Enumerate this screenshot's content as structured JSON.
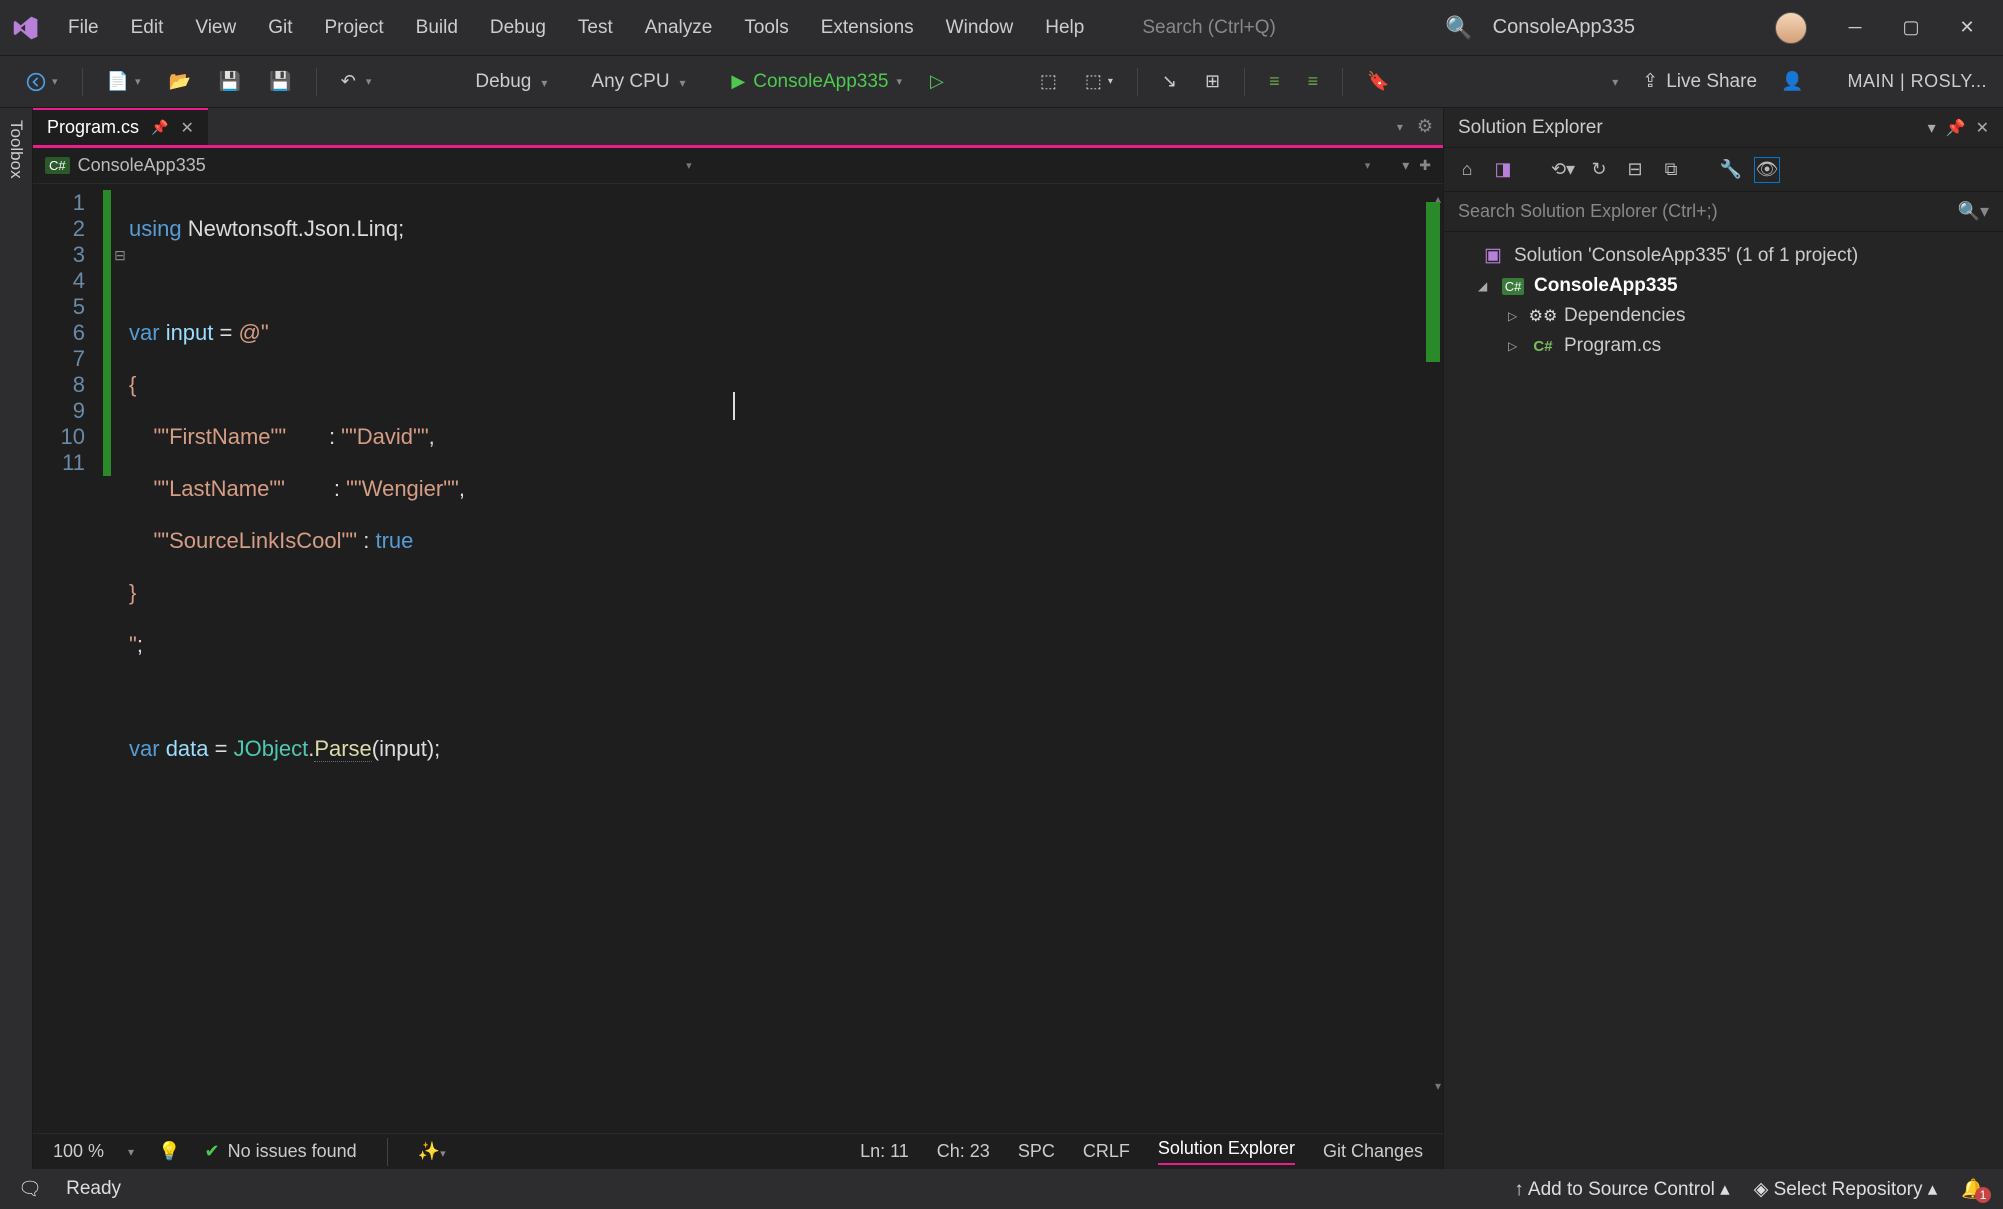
{
  "title": "ConsoleApp335",
  "menu": [
    "File",
    "Edit",
    "View",
    "Git",
    "Project",
    "Build",
    "Debug",
    "Test",
    "Analyze",
    "Tools",
    "Extensions",
    "Window",
    "Help"
  ],
  "search_placeholder": "Search (Ctrl+Q)",
  "toolbar": {
    "config": "Debug",
    "platform": "Any CPU",
    "run_target": "ConsoleApp335",
    "live_share": "Live Share",
    "branch": "MAIN | ROSLY..."
  },
  "toolbox_label": "Toolbox",
  "tab": {
    "name": "Program.cs"
  },
  "nav": {
    "project": "ConsoleApp335"
  },
  "code": {
    "lines": [
      "1",
      "2",
      "3",
      "4",
      "5",
      "6",
      "7",
      "8",
      "9",
      "10",
      "11"
    ],
    "l1_kw": "using",
    "l1_ns": "Newtonsoft",
    "l1_d1": ".",
    "l1_p2": "Json",
    "l1_d2": ".",
    "l1_p3": "Linq",
    "l1_end": ";",
    "l3_kw": "var",
    "l3_id": "input",
    "l3_eq": " = ",
    "l3_str": "@\"",
    "l4": "{",
    "l5_k": "    \"\"FirstName\"\"       ",
    "l5_c": ": ",
    "l5_v": "\"\"David\"\"",
    "l5_e": ",",
    "l6_k": "    \"\"LastName\"\"        ",
    "l6_c": ": ",
    "l6_v": "\"\"Wengier\"\"",
    "l6_e": ",",
    "l7_k": "    \"\"SourceLinkIsCool\"\" ",
    "l7_c": ": ",
    "l7_v": "true",
    "l8": "}",
    "l9": "\"",
    "l9_e": ";",
    "l11_kw": "var",
    "l11_id": "data",
    "l11_eq": " = ",
    "l11_cls": "JObject",
    "l11_d": ".",
    "l11_m": "Parse",
    "l11_a": "(input);"
  },
  "editor_status": {
    "zoom": "100 %",
    "issues": "No issues found",
    "ln": "Ln: 11",
    "ch": "Ch: 23",
    "spc": "SPC",
    "crlf": "CRLF",
    "tab_sol": "Solution Explorer",
    "tab_git": "Git Changes"
  },
  "solution": {
    "title": "Solution Explorer",
    "search_placeholder": "Search Solution Explorer (Ctrl+;)",
    "root": "Solution 'ConsoleApp335' (1 of 1 project)",
    "project": "ConsoleApp335",
    "deps": "Dependencies",
    "file": "Program.cs",
    "cs_badge": "C#"
  },
  "statusbar": {
    "ready": "Ready",
    "add_source": "Add to Source Control",
    "select_repo": "Select Repository",
    "notif_count": "1"
  }
}
